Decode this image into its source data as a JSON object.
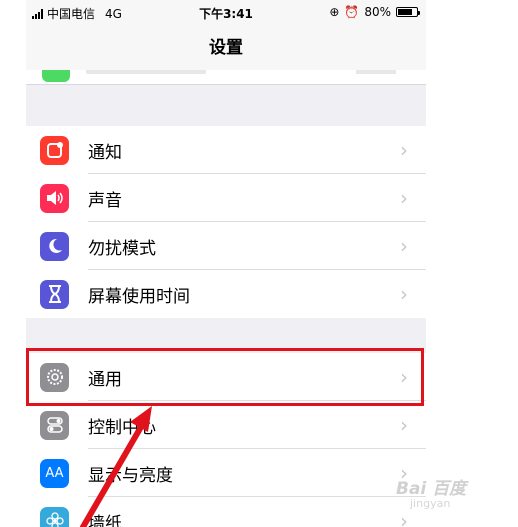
{
  "status_bar": {
    "carrier": "中国电信",
    "network": "4G",
    "time": "下午3:41",
    "battery": "80%",
    "battery_level": 0.8
  },
  "nav": {
    "title": "设置"
  },
  "groups": [
    {
      "items": [
        {
          "label": "通知",
          "icon": "notifications-icon",
          "color": "#ff3b30"
        },
        {
          "label": "声音",
          "icon": "sounds-icon",
          "color": "#ff2d55"
        },
        {
          "label": "勿扰模式",
          "icon": "moon-icon",
          "color": "#5856d6"
        },
        {
          "label": "屏幕使用时间",
          "icon": "hourglass-icon",
          "color": "#5856d6"
        }
      ]
    },
    {
      "items": [
        {
          "label": "通用",
          "icon": "gear-icon",
          "color": "#8e8e93"
        },
        {
          "label": "控制中心",
          "icon": "toggles-icon",
          "color": "#8e8e93"
        },
        {
          "label": "显示与亮度",
          "icon": "text-size-icon",
          "color": "#007aff"
        },
        {
          "label": "墙纸",
          "icon": "flower-icon",
          "color": "#34aadc"
        }
      ]
    }
  ],
  "overlay": {
    "highlight_color": "#e0121b"
  },
  "watermark": {
    "brand": "Bai 百度",
    "sub": "jingyan"
  },
  "icons": {
    "glyph_aa": "AA"
  }
}
